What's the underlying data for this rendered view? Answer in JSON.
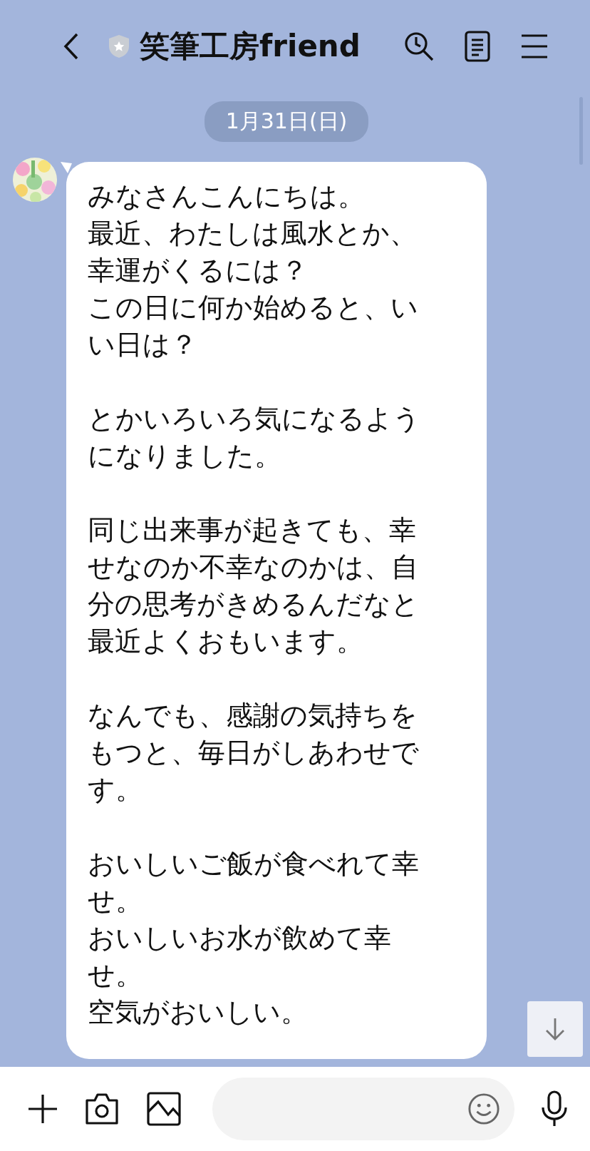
{
  "header": {
    "title": "笑筆工房friend"
  },
  "date_label": "1月31日(日)",
  "messages": [
    {
      "kind": "incoming",
      "avatar": {
        "kind": "picture"
      },
      "paragraphs": [
        [
          "みなさんこんにちは。",
          "最近、わたしは風水とか、",
          "幸運がくるには？",
          "この日に何か始めると、いい日は？"
        ],
        [
          "とかいろいろ気になるようになりました。"
        ],
        [
          "同じ出来事が起きても、幸せなのか不幸なのかは、自分の思考がきめるんだなと最近よくおもいます。"
        ],
        [
          "なんでも、感謝の気持ちをもつと、毎日がしあわせです。"
        ],
        [
          "おいしいご飯が食べれて幸せ。",
          "おいしいお水が飲めて幸せ。",
          "空気がおいしい。"
        ]
      ]
    }
  ]
}
